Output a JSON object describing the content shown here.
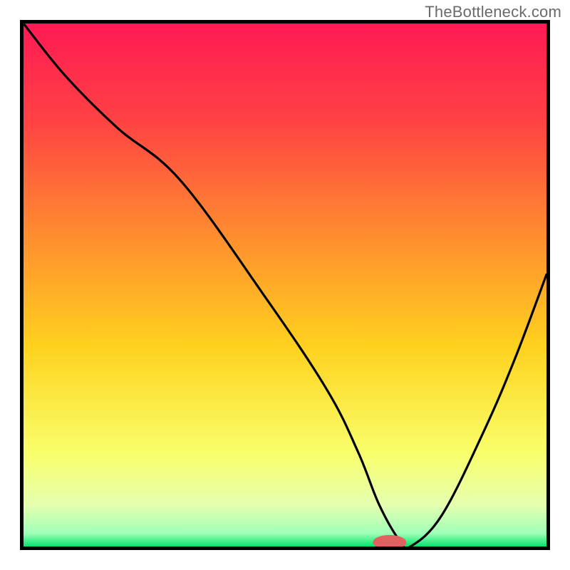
{
  "watermark": "TheBottleneck.com",
  "colors": {
    "border": "#000000",
    "curve": "#000000",
    "marker_fill": "#e0615f",
    "gradient_stops": [
      {
        "offset": 0.0,
        "color": "#ff1a54"
      },
      {
        "offset": 0.18,
        "color": "#ff4044"
      },
      {
        "offset": 0.4,
        "color": "#ff8b2f"
      },
      {
        "offset": 0.62,
        "color": "#ffd21e"
      },
      {
        "offset": 0.82,
        "color": "#f9ff6a"
      },
      {
        "offset": 0.92,
        "color": "#e6ffb0"
      },
      {
        "offset": 0.975,
        "color": "#9fffb8"
      },
      {
        "offset": 1.0,
        "color": "#00e56a"
      }
    ]
  },
  "chart_data": {
    "type": "line",
    "title": "",
    "xlabel": "",
    "ylabel": "",
    "xlim": [
      0,
      100
    ],
    "ylim": [
      0,
      100
    ],
    "series": [
      {
        "name": "bottleneck-curve",
        "x": [
          0,
          8,
          18,
          30,
          46,
          58,
          64,
          68,
          72,
          74,
          80,
          88,
          94,
          100
        ],
        "values": [
          100,
          90,
          80,
          70,
          48,
          30,
          18,
          8,
          1,
          0,
          6,
          22,
          36,
          52
        ]
      }
    ],
    "marker": {
      "x": 70,
      "y": 0.8,
      "rx": 3.2,
      "ry": 1.4
    },
    "annotations": []
  }
}
